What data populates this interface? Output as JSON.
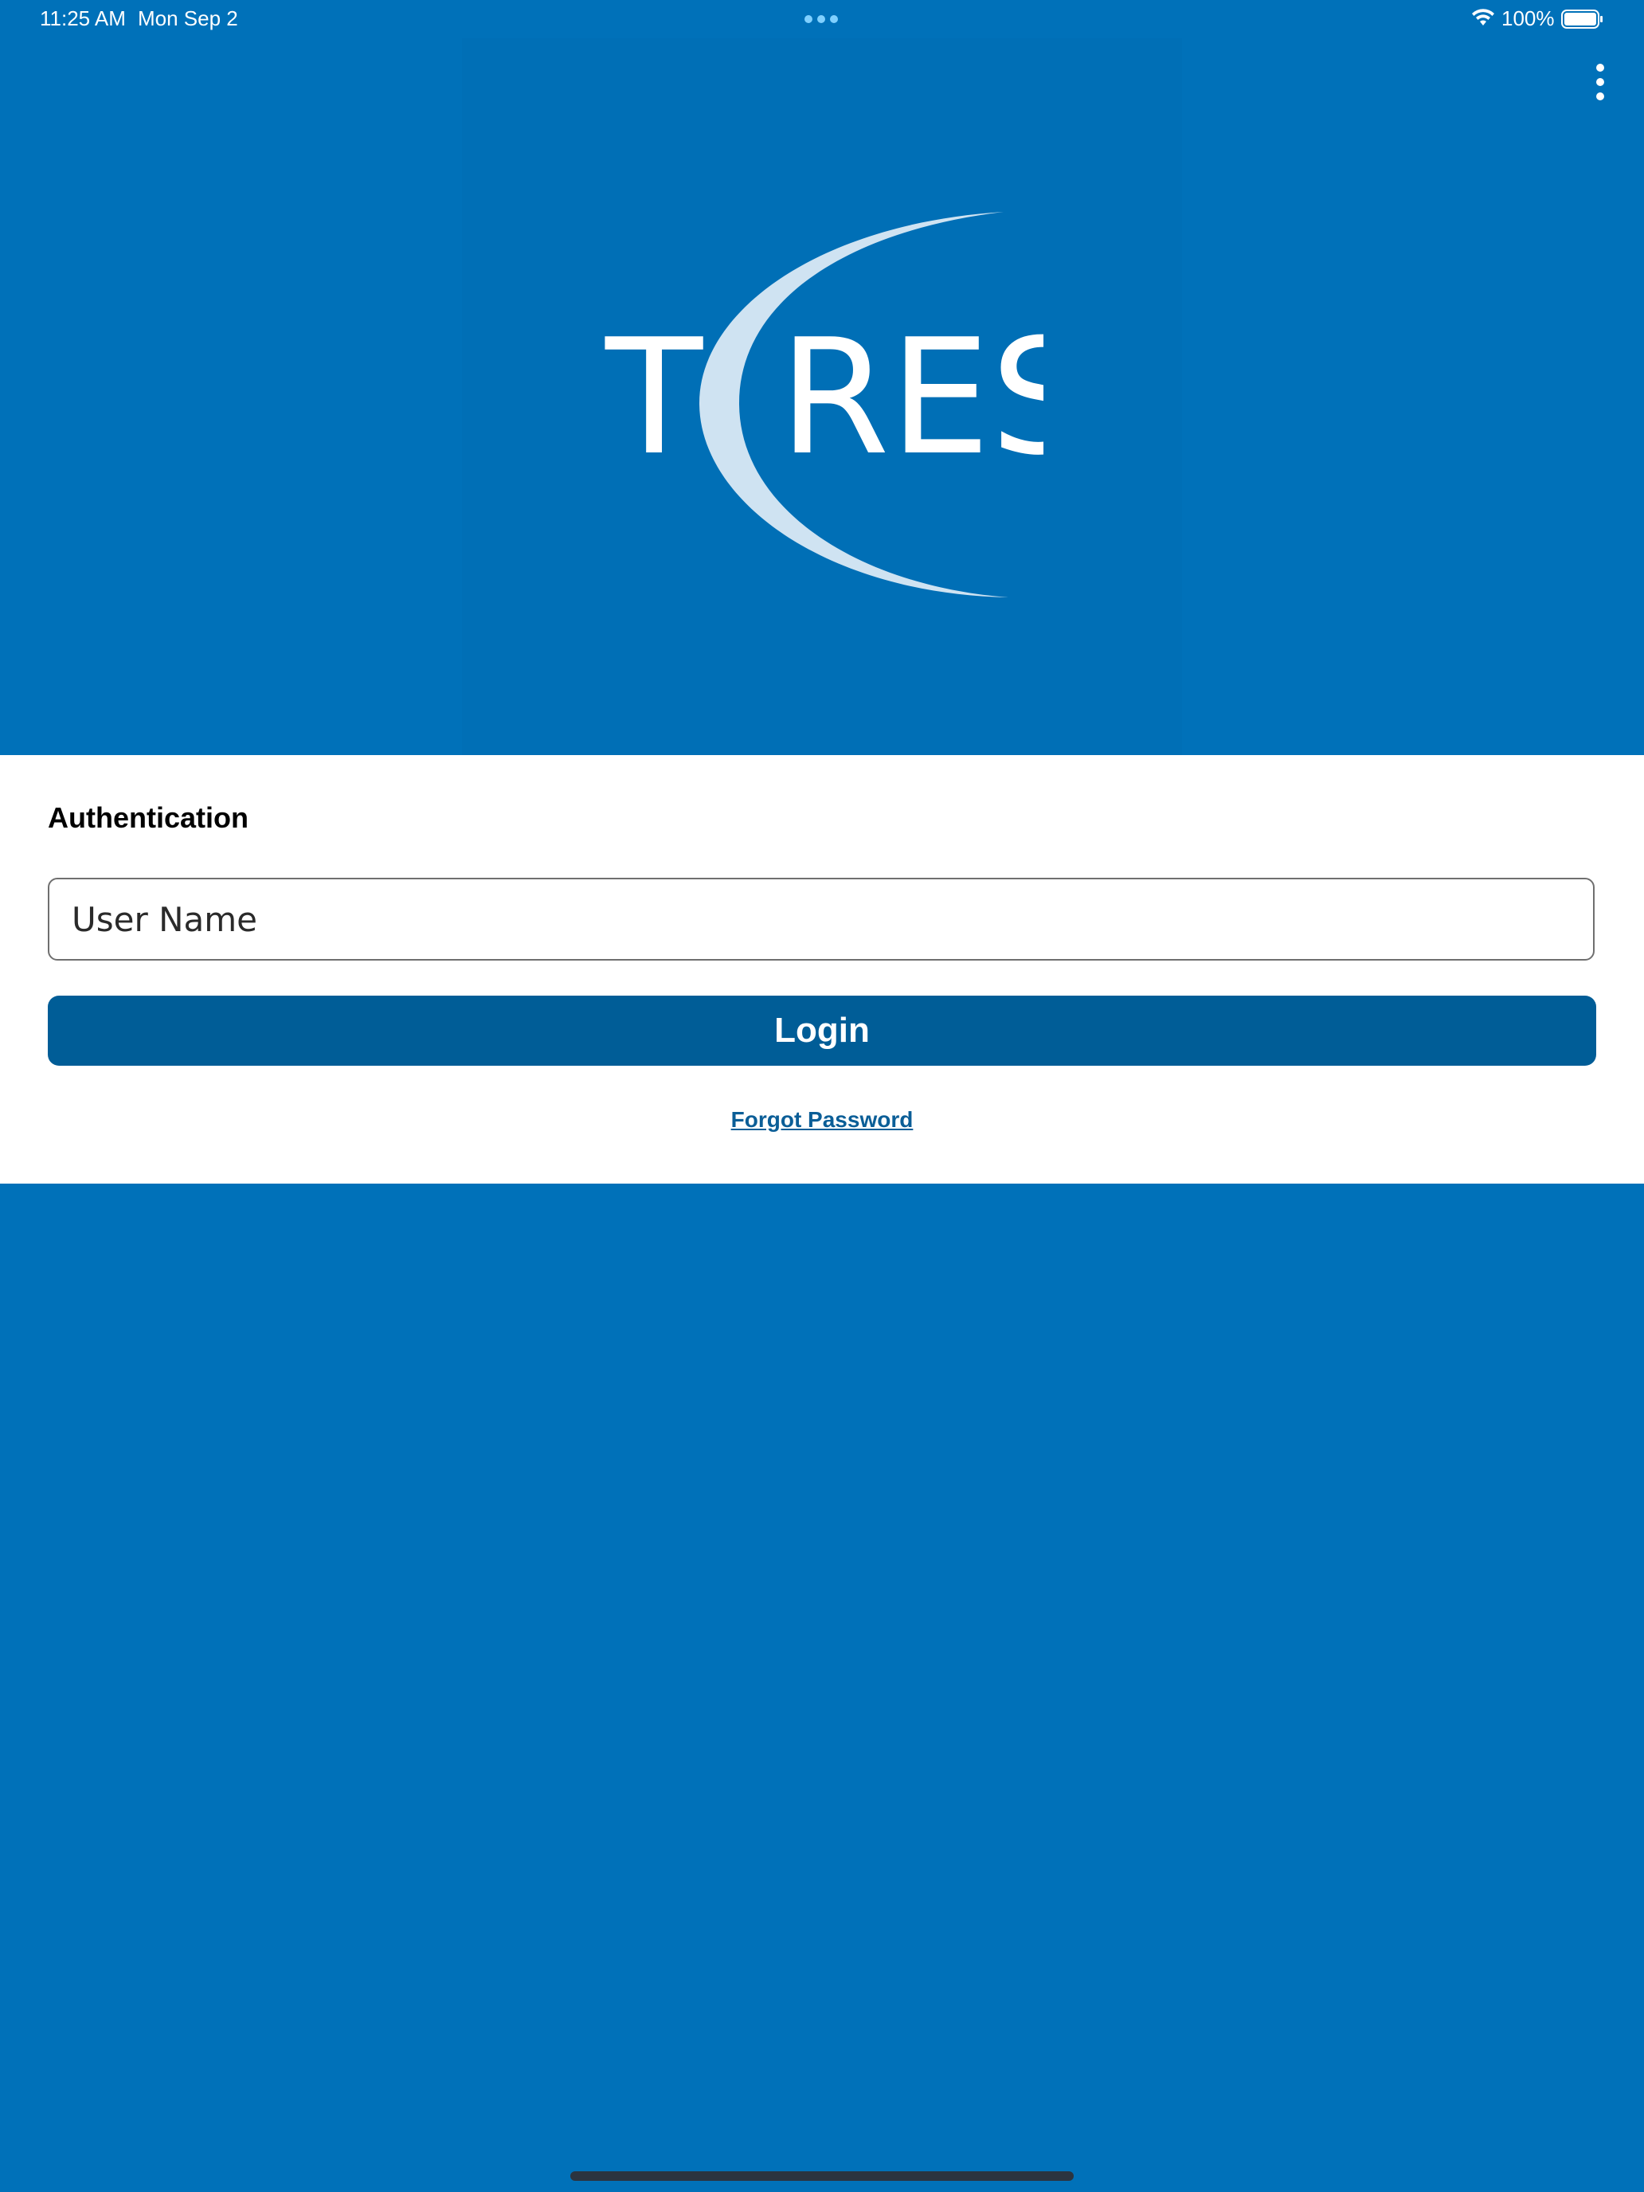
{
  "status_bar": {
    "time": "11:25 AM",
    "date": "Mon Sep 2",
    "battery": "100%"
  },
  "icons": {
    "more": "vertical-ellipsis-icon",
    "wifi": "wifi-icon",
    "battery": "battery-icon",
    "multitask": "multitask-dots-icon"
  },
  "logo": {
    "letters_left": "T",
    "letters_right": "RES"
  },
  "auth": {
    "title": "Authentication",
    "username_placeholder": "User Name",
    "username_value": "",
    "login_label": "Login",
    "forgot_label": "Forgot Password"
  },
  "colors": {
    "background": "#0071B9",
    "button": "#005D97",
    "link": "#0B5E97",
    "logo_arc": "#CFE3F2"
  }
}
